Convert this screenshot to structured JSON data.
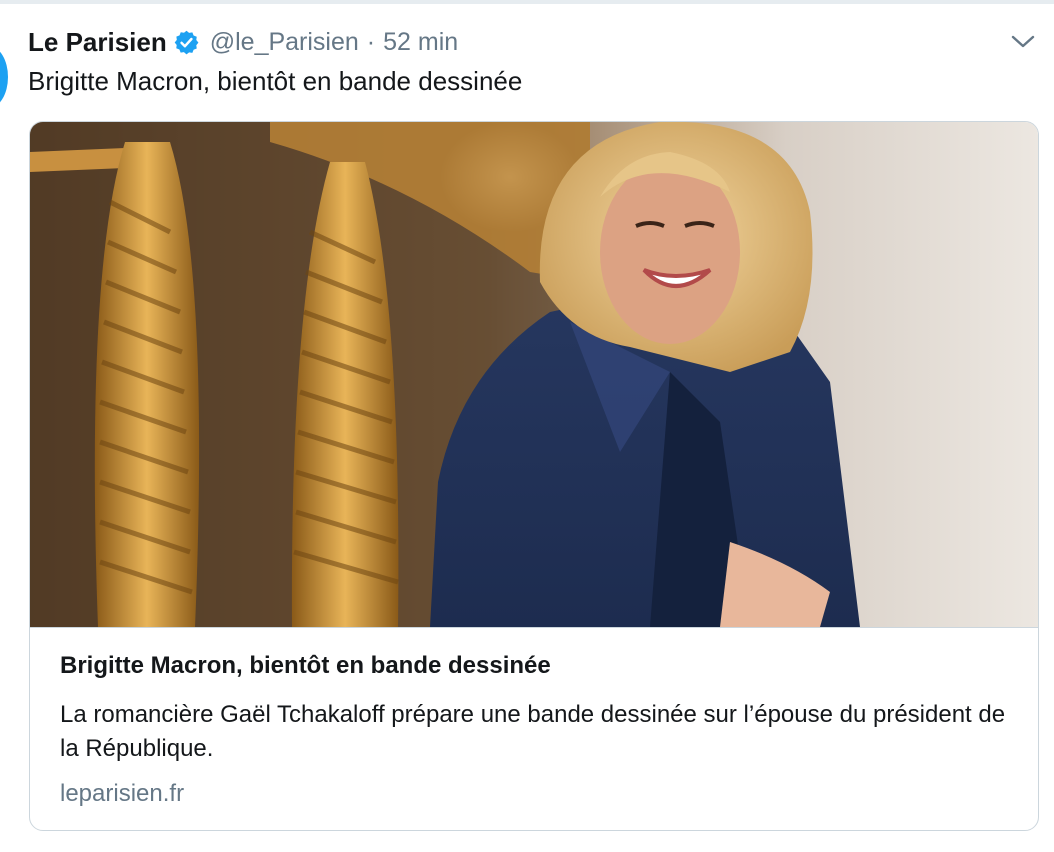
{
  "tweet": {
    "author_name": "Le Parisien",
    "handle": "@le_Parisien",
    "separator": "·",
    "time": "52 min",
    "text": "Brigitte Macron, bientôt en bande dessinée",
    "verified_icon": "verified-badge-icon",
    "menu_icon": "chevron-down-icon"
  },
  "card": {
    "image_description_icon": "photo",
    "title": "Brigitte Macron, bientôt en bande dessinée",
    "description": "La romancière Gaël Tchakaloff prépare une bande dessinée sur l’épouse du président de la République.",
    "domain": "leparisien.fr"
  },
  "colors": {
    "text_primary": "#14171a",
    "text_secondary": "#657786",
    "verified_blue": "#1da1f2",
    "border": "#ccd6dd"
  }
}
